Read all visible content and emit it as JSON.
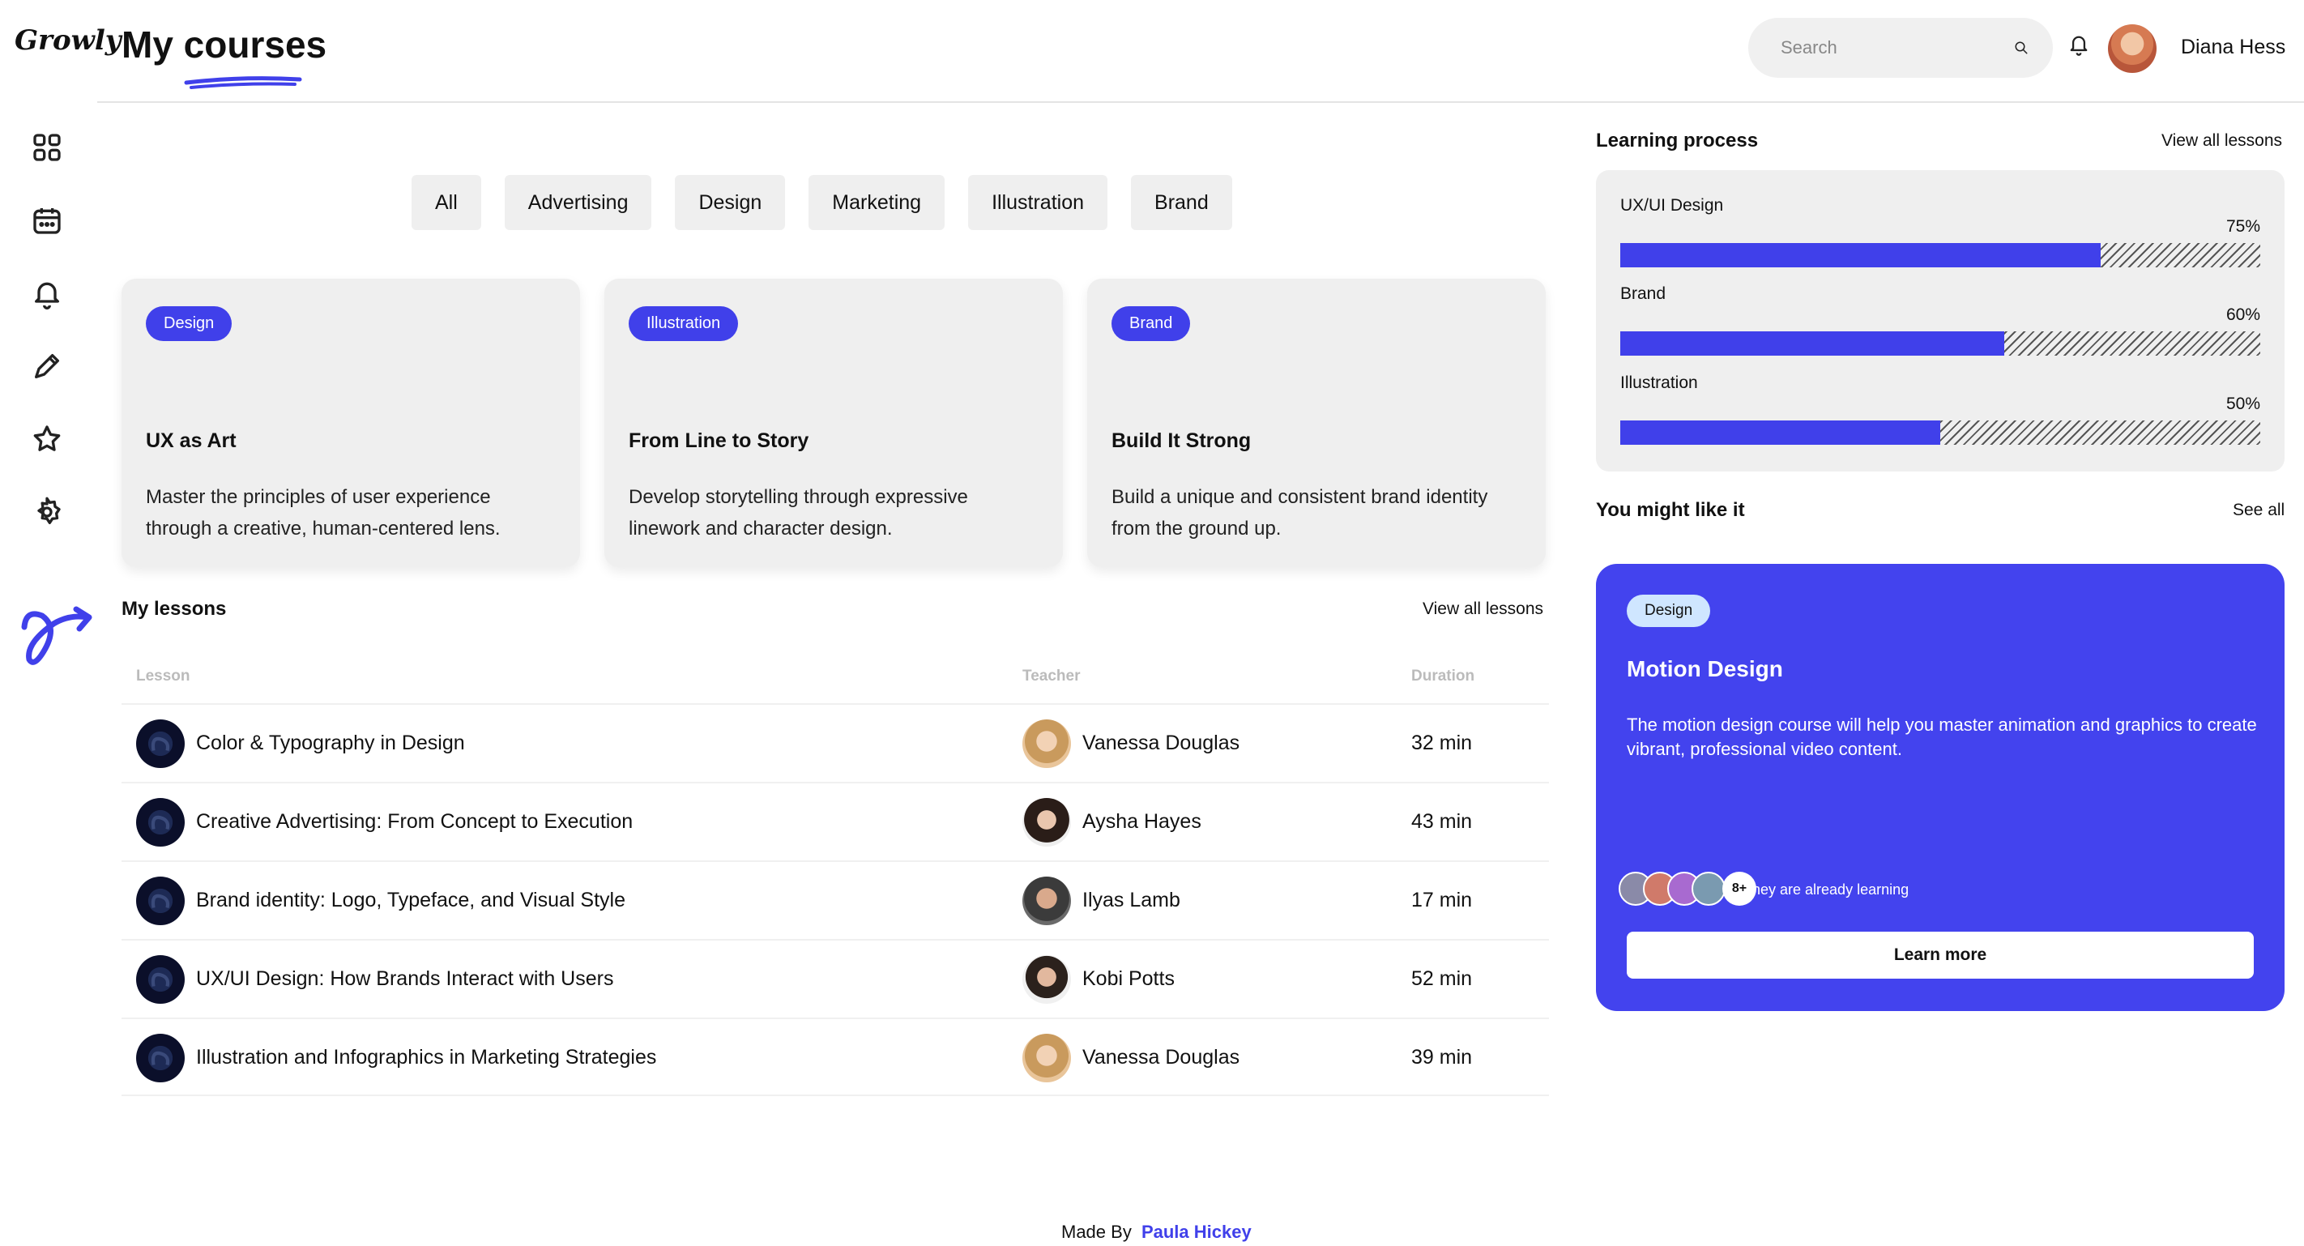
{
  "app": {
    "logo": "Growly",
    "page_title": "My courses"
  },
  "header": {
    "search_placeholder": "Search",
    "user_name": "Diana Hess"
  },
  "sidebar": {
    "items": [
      {
        "icon": "grid-icon"
      },
      {
        "icon": "calendar-icon"
      },
      {
        "icon": "bell-icon"
      },
      {
        "icon": "pencil-icon"
      },
      {
        "icon": "star-icon"
      },
      {
        "icon": "settings-icon"
      }
    ]
  },
  "filters": [
    "All",
    "Advertising",
    "Design",
    "Marketing",
    "Illustration",
    "Brand"
  ],
  "courses": [
    {
      "badge": "Design",
      "title": "UX as Art",
      "description": "Master the principles of user experience through a creative, human-centered lens."
    },
    {
      "badge": "Illustration",
      "title": "From Line to Story",
      "description": "Develop storytelling through expressive linework and character design."
    },
    {
      "badge": "Brand",
      "title": "Build It Strong",
      "description": "Build a unique and consistent brand identity from the ground up."
    }
  ],
  "lessons": {
    "title": "My lessons",
    "view_all": "View all lessons",
    "columns": {
      "lesson": "Lesson",
      "teacher": "Teacher",
      "duration": "Duration"
    },
    "rows": [
      {
        "lesson": "Color & Typography in Design",
        "teacher": "Vanessa Douglas",
        "duration": "32 min"
      },
      {
        "lesson": "Creative Advertising: From Concept to Execution",
        "teacher": "Aysha Hayes",
        "duration": "43 min"
      },
      {
        "lesson": "Brand identity: Logo, Typeface, and Visual Style",
        "teacher": "Ilyas Lamb",
        "duration": "17 min"
      },
      {
        "lesson": "UX/UI Design: How Brands Interact with Users",
        "teacher": "Kobi Potts",
        "duration": "52 min"
      },
      {
        "lesson": "Illustration and Infographics in Marketing Strategies",
        "teacher": "Vanessa Douglas",
        "duration": "39 min"
      }
    ]
  },
  "learning_process": {
    "title": "Learning process",
    "view_all": "View all lessons",
    "items": [
      {
        "label": "UX/UI Design",
        "percent": "75%",
        "value": 0.75
      },
      {
        "label": "Brand",
        "percent": "60%",
        "value": 0.6
      },
      {
        "label": "Illustration",
        "percent": "50%",
        "value": 0.5
      }
    ]
  },
  "recommend": {
    "title": "You might like it",
    "see_all": "See all",
    "badge": "Design",
    "course_title": "Motion Design",
    "description": "The motion design course will help you master animation and graphics to create vibrant, professional video content.",
    "more_count": "8+",
    "learners_text": "They are already learning",
    "button": "Learn more"
  },
  "footer": {
    "prefix": "Made By",
    "author": "Paula Hickey"
  },
  "colors": {
    "accent": "#4040ea",
    "card_bg": "#efefef"
  }
}
